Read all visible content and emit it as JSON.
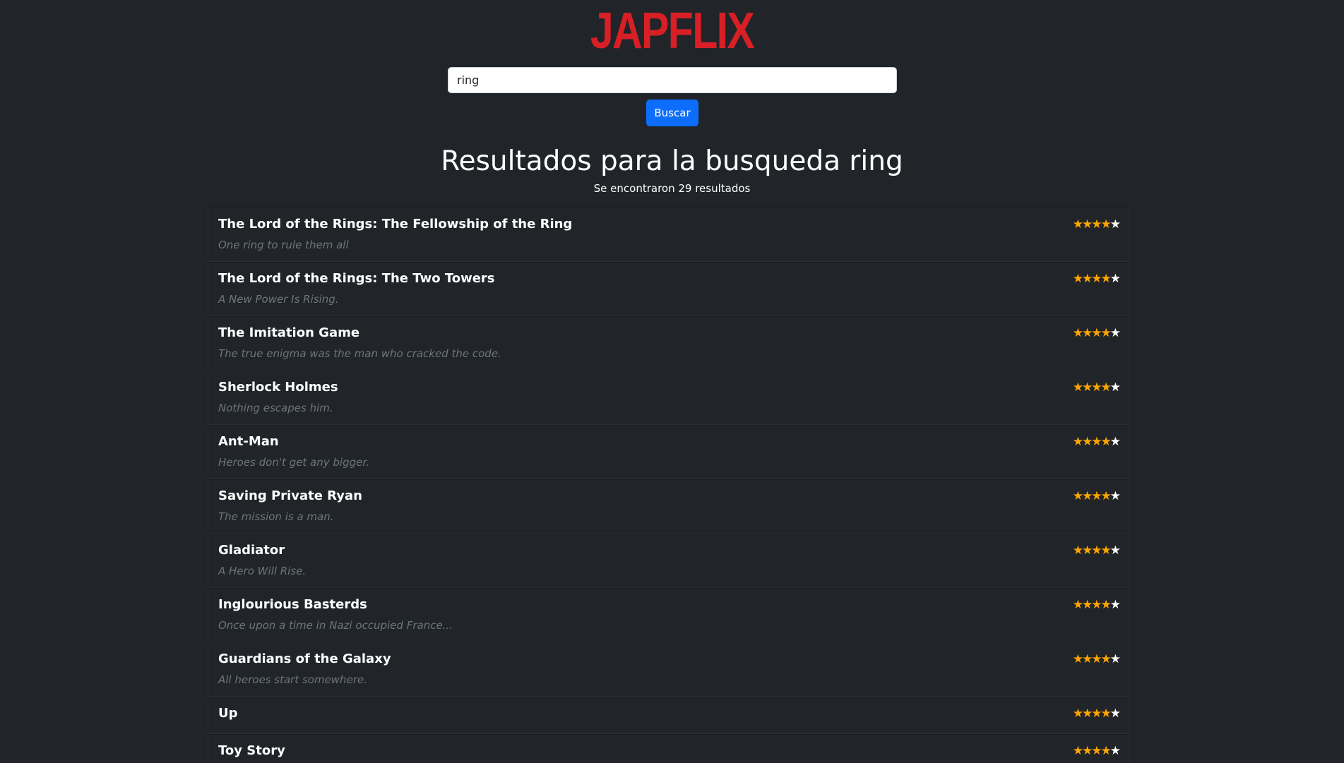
{
  "header": {
    "logo_text": "JAPFLIX"
  },
  "search": {
    "value": "ring",
    "button_label": "Buscar"
  },
  "results": {
    "title": "Resultados para la busqueda ring",
    "count_text": "Se encontraron 29 resultados",
    "items": [
      {
        "title": "The Lord of the Rings: The Fellowship of the Ring",
        "tagline": "One ring to rule them all",
        "rating": 4,
        "max_rating": 5
      },
      {
        "title": "The Lord of the Rings: The Two Towers",
        "tagline": "A New Power Is Rising.",
        "rating": 4,
        "max_rating": 5
      },
      {
        "title": "The Imitation Game",
        "tagline": "The true enigma was the man who cracked the code.",
        "rating": 4,
        "max_rating": 5
      },
      {
        "title": "Sherlock Holmes",
        "tagline": "Nothing escapes him.",
        "rating": 4,
        "max_rating": 5
      },
      {
        "title": "Ant-Man",
        "tagline": "Heroes don't get any bigger.",
        "rating": 4,
        "max_rating": 5
      },
      {
        "title": "Saving Private Ryan",
        "tagline": "The mission is a man.",
        "rating": 4,
        "max_rating": 5
      },
      {
        "title": "Gladiator",
        "tagline": "A Hero Will Rise.",
        "rating": 4,
        "max_rating": 5
      },
      {
        "title": "Inglourious Basterds",
        "tagline": "Once upon a time in Nazi occupied France...",
        "rating": 4,
        "max_rating": 5
      },
      {
        "title": "Guardians of the Galaxy",
        "tagline": "All heroes start somewhere.",
        "rating": 4,
        "max_rating": 5
      },
      {
        "title": "Up",
        "tagline": "",
        "rating": 4,
        "max_rating": 5
      },
      {
        "title": "Toy Story",
        "tagline": "",
        "rating": 4,
        "max_rating": 5
      }
    ]
  },
  "colors": {
    "background": "#212529",
    "logo": "#d81f26",
    "button": "#0d6efd",
    "star_filled": "#ffa500",
    "star_empty": "#ffffff",
    "tagline": "#6c757d"
  }
}
